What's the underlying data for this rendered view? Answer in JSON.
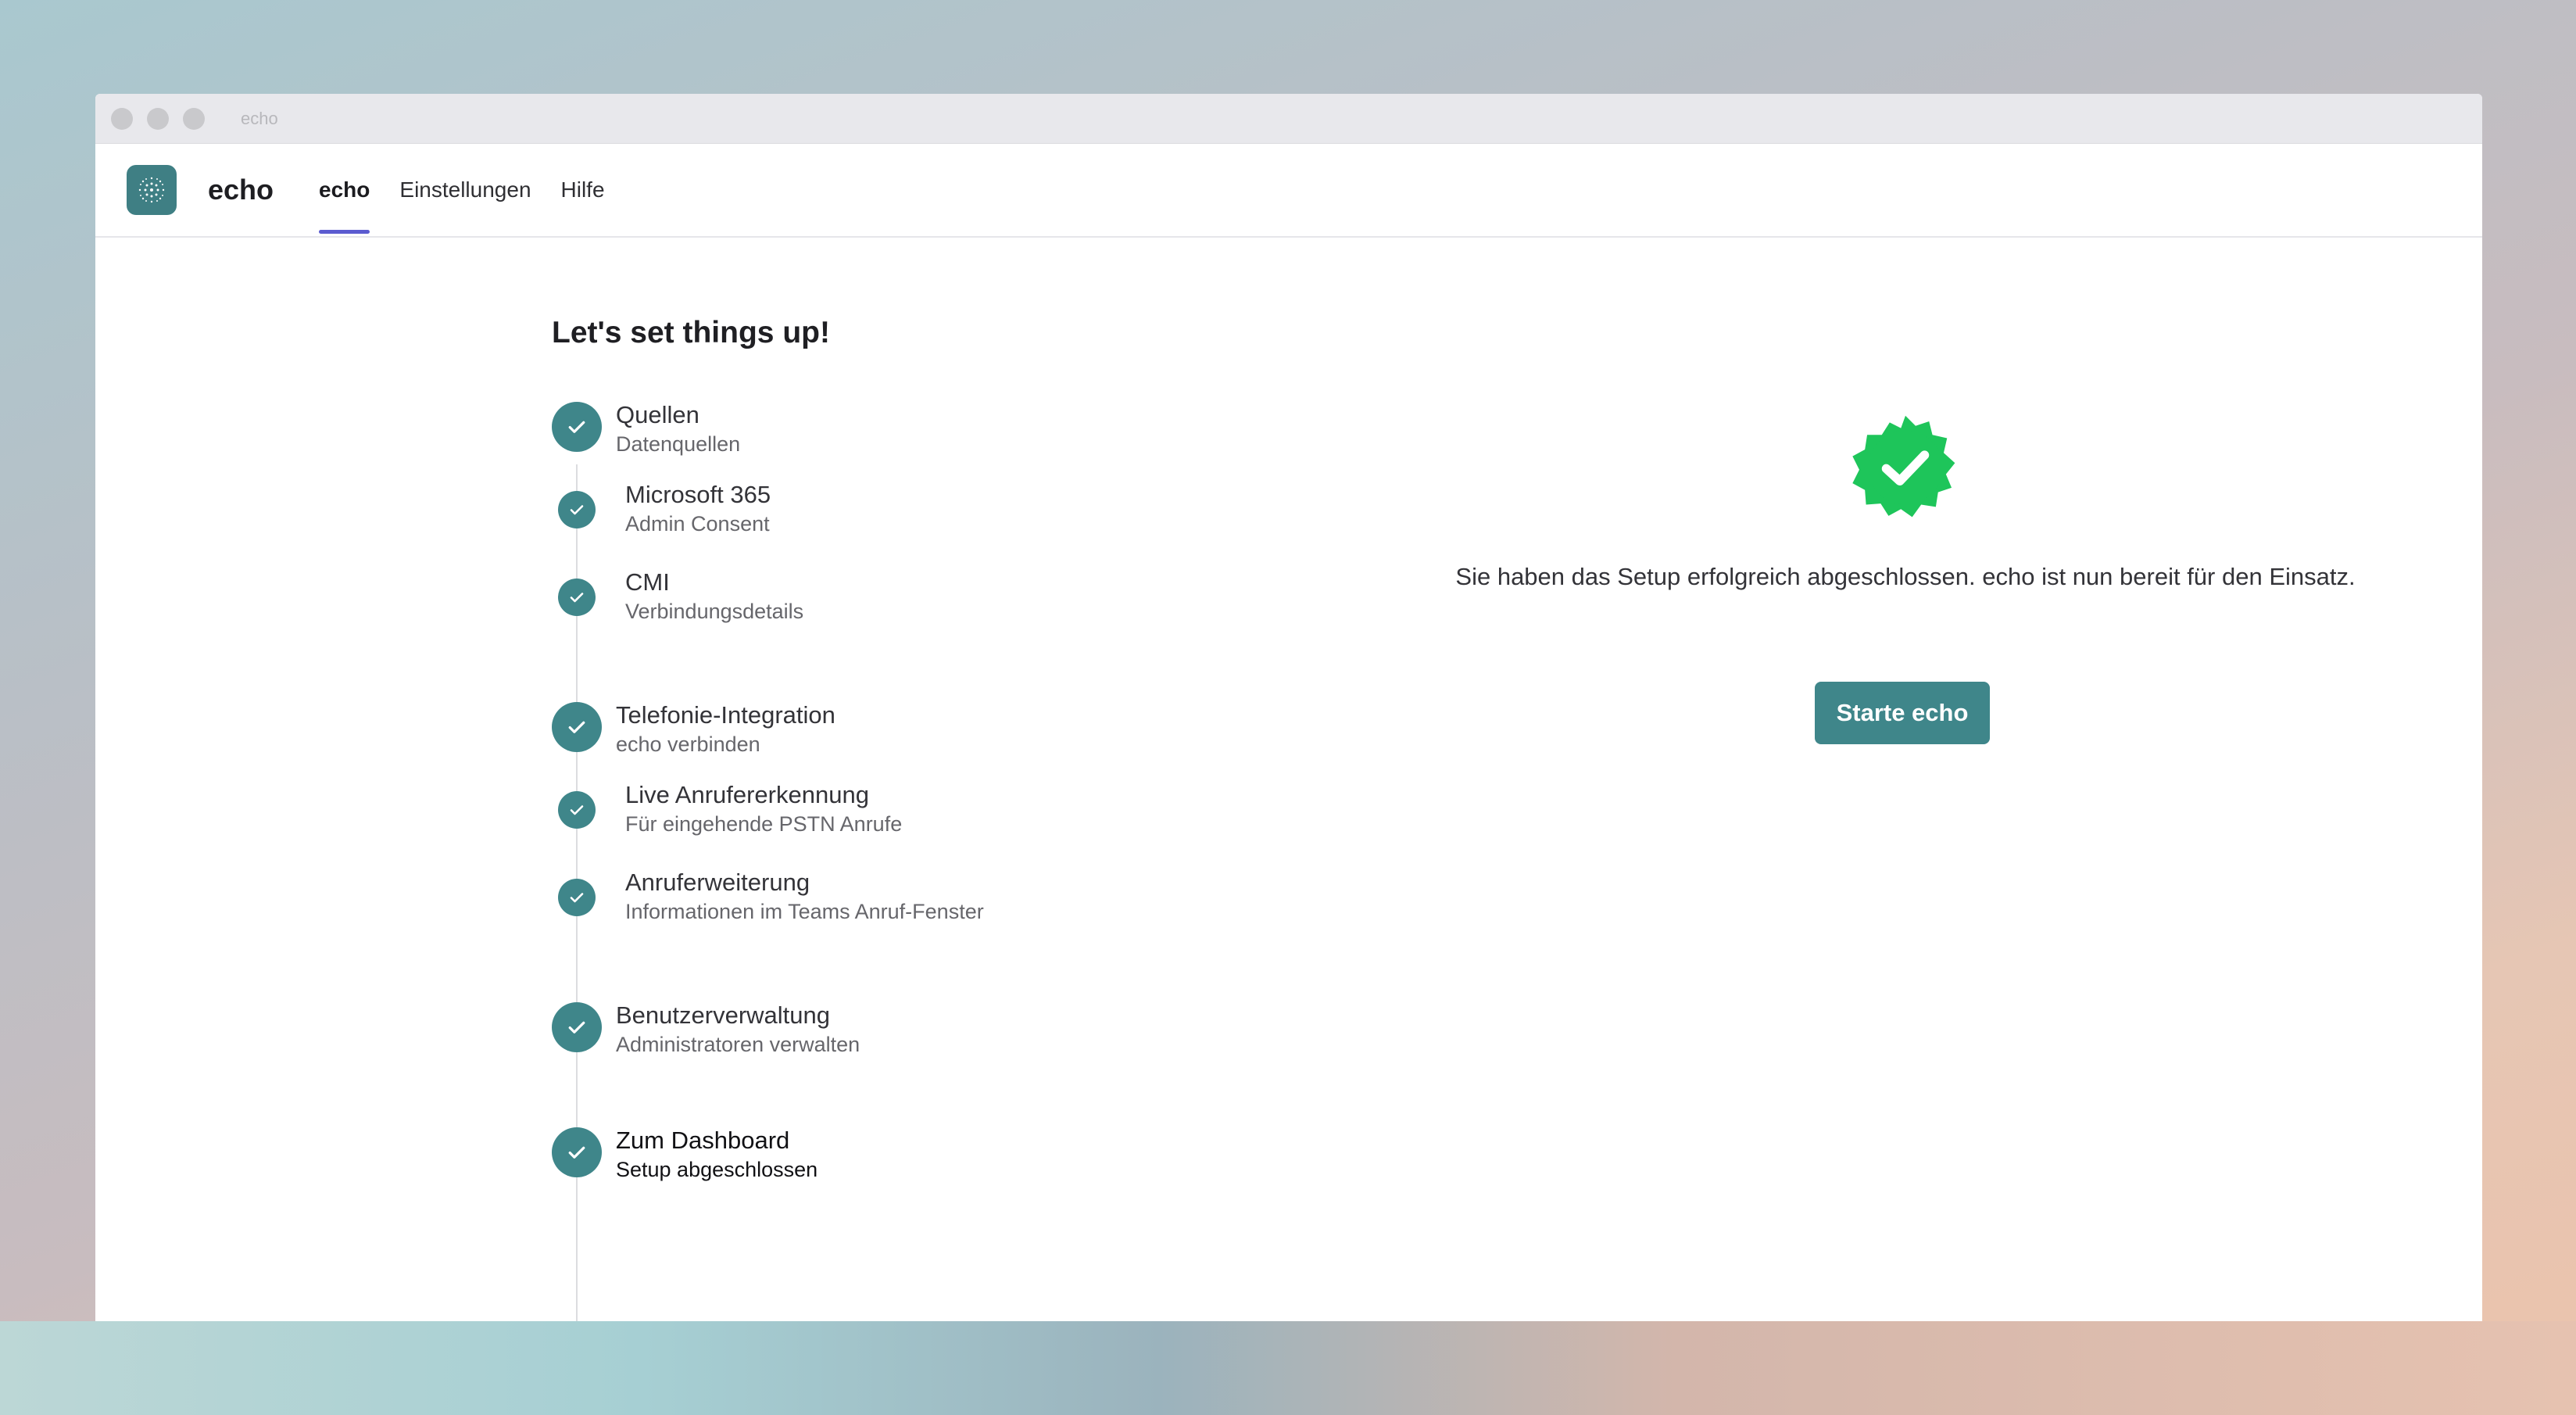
{
  "window": {
    "title": "echo"
  },
  "nav": {
    "brand": "echo",
    "items": [
      {
        "label": "echo",
        "active": true
      },
      {
        "label": "Einstellungen",
        "active": false
      },
      {
        "label": "Hilfe",
        "active": false
      }
    ]
  },
  "setup": {
    "title": "Let's set things up!",
    "steps": [
      {
        "title": "Quellen",
        "subtitle": "Datenquellen",
        "level": "main",
        "completed": true
      },
      {
        "title": "Microsoft 365",
        "subtitle": "Admin Consent",
        "level": "sub",
        "completed": true
      },
      {
        "title": "CMI",
        "subtitle": "Verbindungsdetails",
        "level": "sub",
        "completed": true
      },
      {
        "title": "Telefonie-Integration",
        "subtitle": "echo verbinden",
        "level": "main",
        "completed": true
      },
      {
        "title": "Live Anrufererkennung",
        "subtitle": "Für eingehende PSTN Anrufe",
        "level": "sub",
        "completed": true
      },
      {
        "title": "Anruferweiterung",
        "subtitle": "Informationen im Teams Anruf-Fenster",
        "level": "sub",
        "completed": true
      },
      {
        "title": "Benutzerverwaltung",
        "subtitle": "Administratoren verwalten",
        "level": "main",
        "completed": true
      },
      {
        "title": "Zum Dashboard",
        "subtitle": "Setup abgeschlossen",
        "level": "main",
        "completed": true
      }
    ]
  },
  "success": {
    "message": "Sie haben das Setup erfolgreich abgeschlossen. echo ist nun bereit für den Einsatz.",
    "button_label": "Starte echo"
  },
  "colors": {
    "accent": "#3f868a",
    "success": "#1ec55a",
    "nav_indicator": "#5b5bd0"
  },
  "icons": {
    "logo": "echo-logo-icon",
    "step_check": "check-icon",
    "success_badge": "verified-badge-icon"
  }
}
